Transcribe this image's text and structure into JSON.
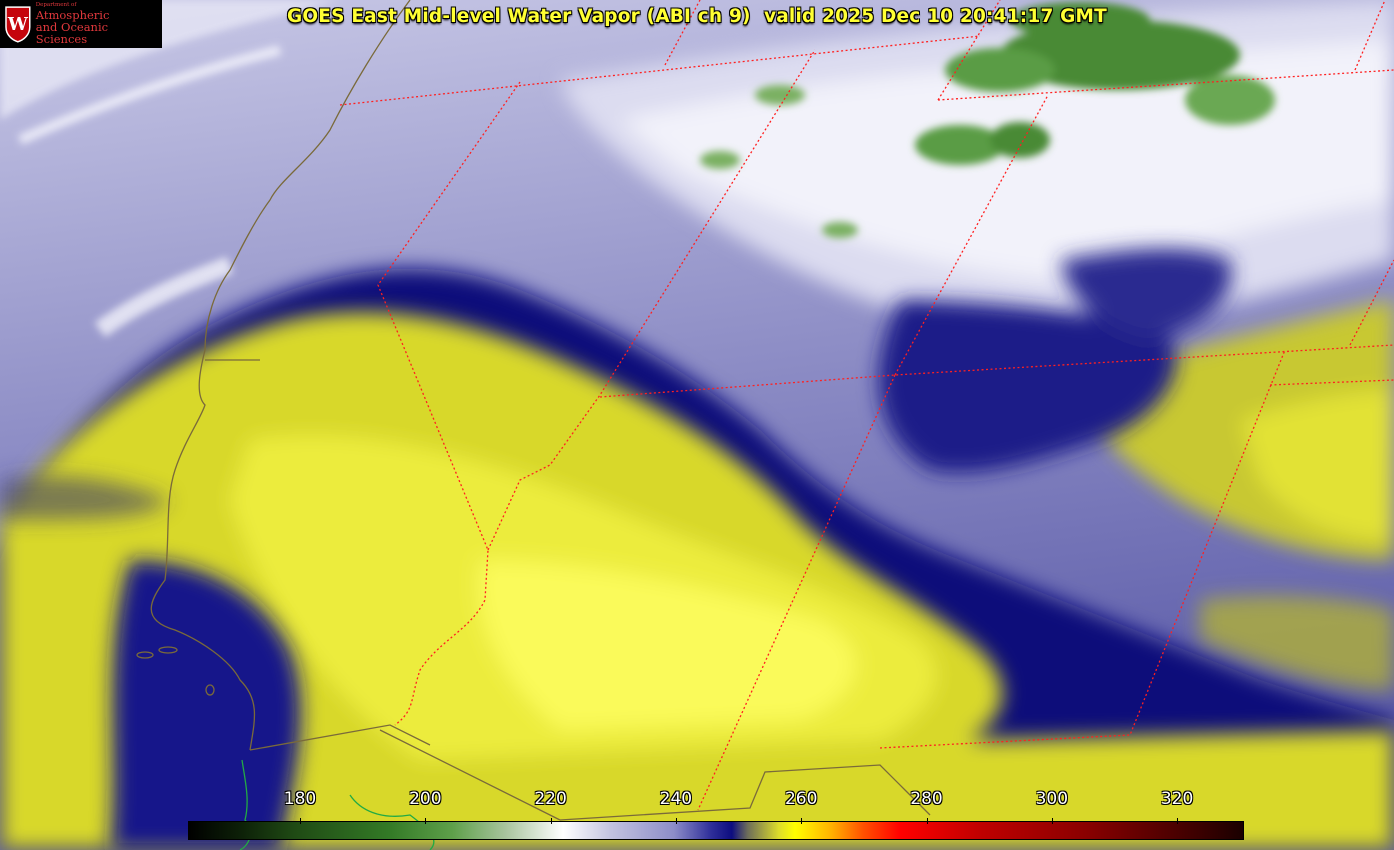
{
  "title": "GOES East Mid-level Water Vapor (ABI ch 9)  valid 2025 Dec 10 20:41:17 GMT",
  "logo": {
    "department": "Department of",
    "line1": "Atmospheric",
    "line2": "and Oceanic Sciences",
    "crest_letter": "W",
    "crest_color": "#c5050c"
  },
  "colorbar": {
    "labels": [
      "180",
      "200",
      "220",
      "240",
      "260",
      "280",
      "300",
      "320"
    ]
  },
  "colors": {
    "title": "#ffff33",
    "boundary": "#ff2020",
    "coastline": "#7a6a3a",
    "dry_air": "#e6e62a",
    "moist_blue": "#10107a",
    "cold_cloud_green": "#4a8a36"
  }
}
